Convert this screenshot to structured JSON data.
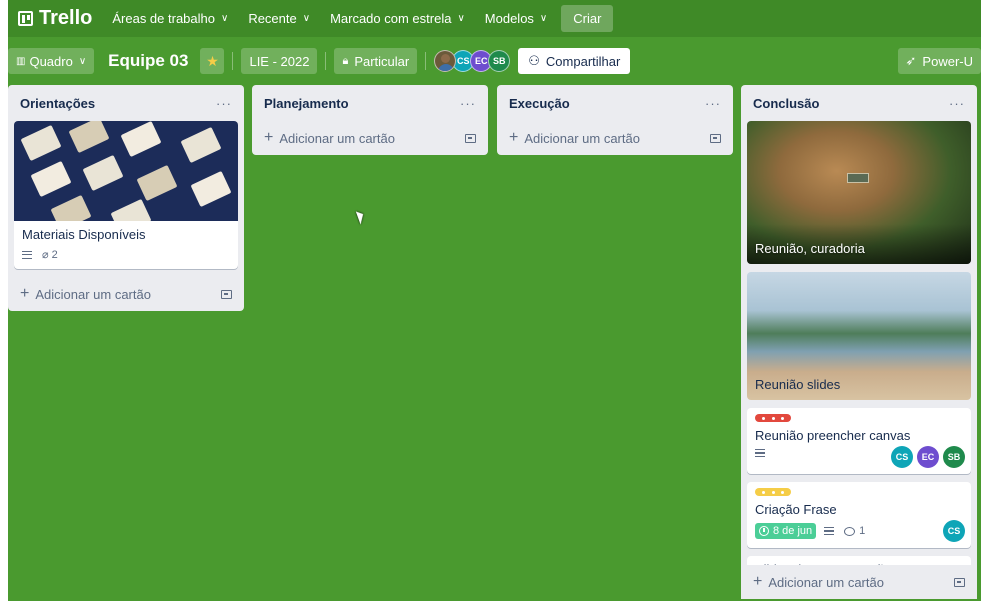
{
  "topbar": {
    "logo": "Trello",
    "nav": [
      "Áreas de trabalho",
      "Recente",
      "Marcado com estrela",
      "Modelos"
    ],
    "create": "Criar"
  },
  "boardbar": {
    "view": "Quadro",
    "title": "Equipe 03",
    "workspace": "LIE - 2022",
    "visibility": "Particular",
    "members": [
      "CS",
      "EC",
      "SB"
    ],
    "share": "Compartilhar",
    "powerups": "Power-U"
  },
  "colors": {
    "cs": "#0ea5b7",
    "ec": "#6e4dcf",
    "sb": "#1f8a4c",
    "label_red": "#e2483d",
    "label_yellow": "#f5cd47",
    "due_green": "#4bce97"
  },
  "lists": [
    {
      "title": "Orientações",
      "cards": [
        {
          "title": "Materiais Disponíveis",
          "attachments": "2"
        }
      ],
      "add": "Adicionar um cartão"
    },
    {
      "title": "Planejamento",
      "cards": [],
      "add": "Adicionar um cartão"
    },
    {
      "title": "Execução",
      "cards": [],
      "add": "Adicionar um cartão"
    },
    {
      "title": "Conclusão",
      "cards": [
        {
          "title": "Reunião, curadoria"
        },
        {
          "title": "Reunião slides"
        },
        {
          "title": "Reunião preencher canvas",
          "members": [
            "CS",
            "EC",
            "SB"
          ]
        },
        {
          "title": "Criação Frase",
          "due": "8 de jun",
          "comments": "1",
          "members": [
            "CS"
          ]
        },
        {
          "title": "Slides de apresentação"
        }
      ],
      "add": "Adicionar um cartão"
    }
  ]
}
